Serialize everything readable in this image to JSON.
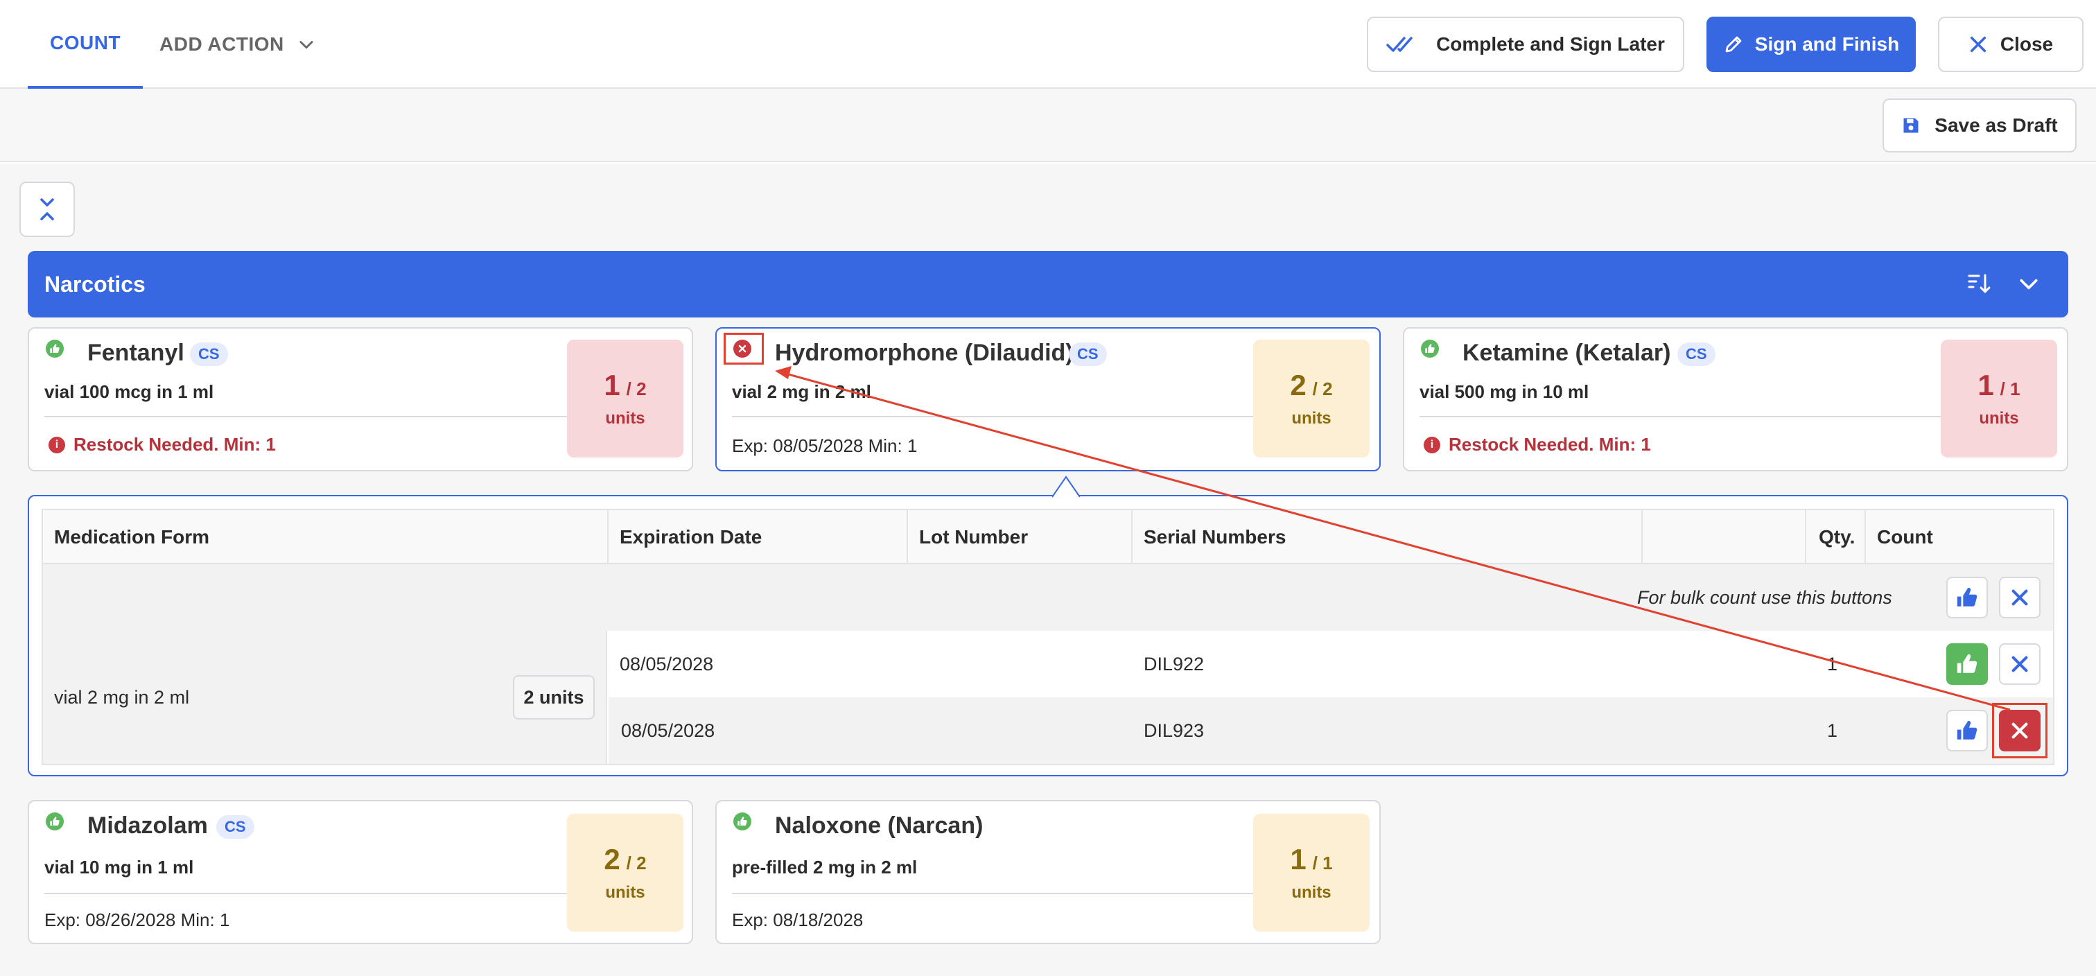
{
  "header": {
    "tabs": {
      "count": "COUNT",
      "add_action": "ADD ACTION"
    },
    "buttons": {
      "complete_later": "Complete and Sign Later",
      "sign_finish": "Sign and Finish",
      "close": "Close",
      "save_draft": "Save as Draft"
    }
  },
  "section": {
    "title": "Narcotics"
  },
  "cards": [
    {
      "status": "ok",
      "name": "Fentanyl",
      "tag": "CS",
      "desc": "vial 100 mcg in 1 ml",
      "footer": "Restock Needed.  Min: 1",
      "counted": "1",
      "total": "/ 2",
      "unit": "units",
      "badge": "red"
    },
    {
      "status": "error",
      "name": "Hydromorphone (Dilaudid)",
      "tag": "CS",
      "desc": "vial 2 mg in 2 ml",
      "footer": "Exp: 08/05/2028  Min: 1",
      "counted": "2",
      "total": "/ 2",
      "unit": "units",
      "badge": "yellow"
    },
    {
      "status": "ok",
      "name": "Ketamine (Ketalar)",
      "tag": "CS",
      "desc": "vial 500 mg in 10 ml",
      "footer": "Restock Needed.  Min: 1",
      "counted": "1",
      "total": "/ 1",
      "unit": "units",
      "badge": "red"
    },
    {
      "status": "ok",
      "name": "Midazolam",
      "tag": "CS",
      "desc": "vial 10 mg in 1 ml",
      "footer": "Exp: 08/26/2028  Min: 1",
      "counted": "2",
      "total": "/ 2",
      "unit": "units",
      "badge": "yellow"
    },
    {
      "status": "ok",
      "name": "Naloxone (Narcan)",
      "tag": "",
      "desc": "pre-filled 2 mg in 2 ml",
      "footer": "Exp: 08/18/2028",
      "counted": "1",
      "total": "/ 1",
      "unit": "units",
      "badge": "yellow"
    }
  ],
  "detail": {
    "columns": [
      "Medication Form",
      "Expiration Date",
      "Lot Number",
      "Serial Numbers",
      "",
      "Qty.",
      "Count"
    ],
    "bulk_hint": "For bulk count use this buttons",
    "form": "vial 2 mg in 2 ml",
    "form_units": "2 units",
    "rows": [
      {
        "expiration": "08/05/2028",
        "lot": "",
        "serial": "DIL922",
        "qty": "1",
        "count_state": "ok"
      },
      {
        "expiration": "08/05/2028",
        "lot": "",
        "serial": "DIL923",
        "qty": "1",
        "count_state": "rejected"
      }
    ]
  },
  "colors": {
    "accent": "#3867e2",
    "ok": "#5cb85c",
    "error": "#c9393f",
    "restock": "#b3323b",
    "annotation": "#e0422f"
  }
}
